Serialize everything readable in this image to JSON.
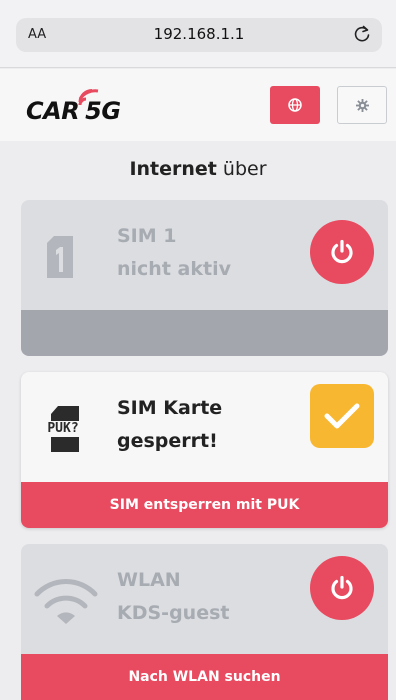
{
  "browser": {
    "text_size_label": "AA",
    "url": "192.168.1.1"
  },
  "header": {
    "logo_text": "CAR 5G",
    "logo_prefix": "CAR",
    "logo_suffix": "5G",
    "globe_icon": "globe-icon",
    "settings_icon": "gear-icon"
  },
  "section": {
    "title_bold": "Internet",
    "title_rest": " über"
  },
  "cards": [
    {
      "line1": "SIM 1",
      "line2": "nicht aktiv",
      "icon": "sim-icon",
      "status_icon": "power-icon",
      "footer": ""
    },
    {
      "line1": "SIM Karte",
      "line2": "gesperrt!",
      "icon": "puk-sim-icon",
      "icon_label": "PUK?",
      "status_icon": "check-icon",
      "footer": "SIM entsperren mit PUK"
    },
    {
      "line1": "WLAN",
      "line2": "KDS-guest",
      "icon": "wifi-icon",
      "status_icon": "power-icon",
      "footer": "Nach WLAN suchen"
    }
  ],
  "colors": {
    "accent": "#e84a5f",
    "warning": "#f7b731",
    "inactive_card": "#dcdde1",
    "inactive_footer": "#a3a7ad"
  }
}
